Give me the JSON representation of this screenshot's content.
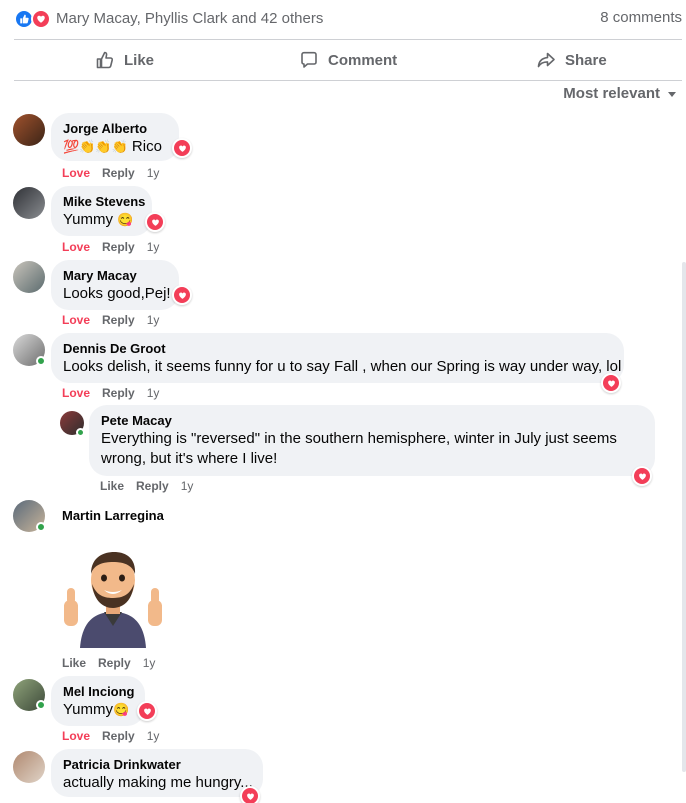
{
  "reactions_summary": {
    "names": "Mary Macay, Phyllis Clark and 42 others",
    "comments_count": "8 comments"
  },
  "actions": {
    "like": "Like",
    "comment": "Comment",
    "share": "Share"
  },
  "sort": {
    "label": "Most relevant"
  },
  "comments": [
    {
      "author": "Jorge Alberto",
      "text": "Rico",
      "emoji_prefix": "💯👏👏👏",
      "reaction": "Love",
      "reply": "Reply",
      "time": "1y"
    },
    {
      "author": "Mike Stevens",
      "text": "Yummy",
      "emoji_suffix": "😋",
      "reaction": "Love",
      "reply": "Reply",
      "time": "1y"
    },
    {
      "author": "Mary Macay",
      "text": "Looks good,Pej!",
      "reaction": "Love",
      "reply": "Reply",
      "time": "1y"
    },
    {
      "author": "Dennis De Groot",
      "text": "Looks delish, it seems funny for u to say Fall , when our Spring is way under way, lol",
      "reaction": "Love",
      "reply": "Reply",
      "time": "1y"
    },
    {
      "author": "Pete Macay",
      "text": "Everything is \"reversed\" in the southern hemisphere, winter in July just seems wrong, but it's where I live!",
      "reaction": "Like",
      "reply": "Reply",
      "time": "1y"
    },
    {
      "author": "Martin Larregina",
      "reaction": "Like",
      "reply": "Reply",
      "time": "1y"
    },
    {
      "author": "Mel Inciong",
      "text": "Yummy",
      "emoji_suffix": "😋",
      "reaction": "Love",
      "reply": "Reply",
      "time": "1y"
    },
    {
      "author": "Patricia Drinkwater",
      "text": "actually making me hungry..."
    }
  ],
  "colors": {
    "love": "#f33e58",
    "like": "#1877f2",
    "bubble": "#f0f2f5",
    "muted": "#65676b",
    "online": "#31a24c"
  }
}
